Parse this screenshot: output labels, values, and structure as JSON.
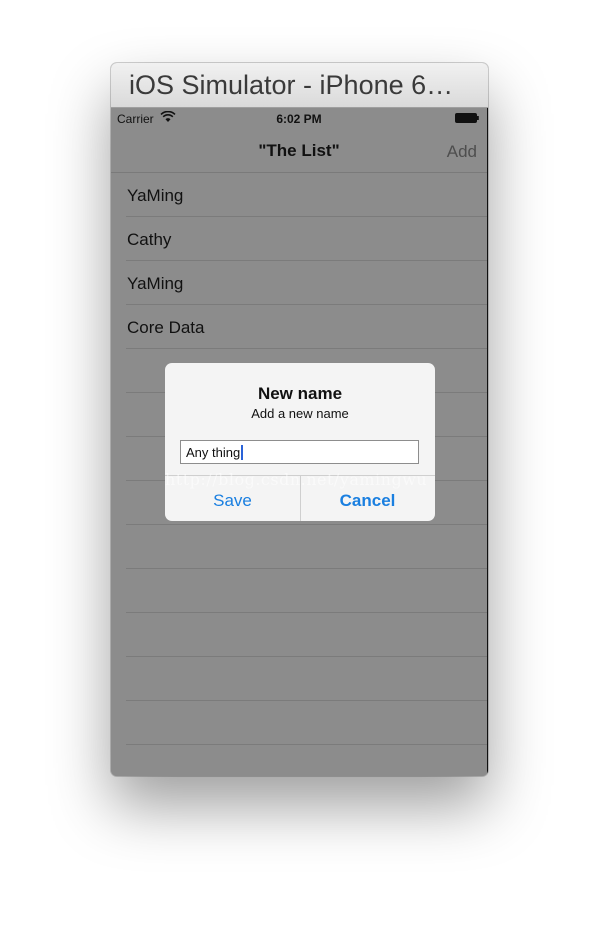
{
  "window": {
    "title": "iOS Simulator - iPhone 6…"
  },
  "statusbar": {
    "carrier": "Carrier",
    "time": "6:02 PM",
    "wifi_icon": "wifi-icon",
    "battery_icon": "battery-icon"
  },
  "navbar": {
    "title": "\"The List\"",
    "add_label": "Add"
  },
  "list": {
    "items": [
      {
        "label": "YaMing"
      },
      {
        "label": "Cathy"
      },
      {
        "label": "YaMing"
      },
      {
        "label": "Core Data"
      },
      {
        "label": ""
      },
      {
        "label": ""
      },
      {
        "label": ""
      },
      {
        "label": ""
      },
      {
        "label": ""
      },
      {
        "label": ""
      },
      {
        "label": ""
      },
      {
        "label": ""
      },
      {
        "label": ""
      },
      {
        "label": ""
      }
    ]
  },
  "alert": {
    "title": "New name",
    "message": "Add a new name",
    "input_value": "Any thing",
    "save_label": "Save",
    "cancel_label": "Cancel"
  },
  "watermark": "http://blog.csdn.net/yamingwu",
  "colors": {
    "accent": "#1a7fe0",
    "dimmed_background": "#8c8c8c",
    "alert_background": "#f4f4f4"
  }
}
